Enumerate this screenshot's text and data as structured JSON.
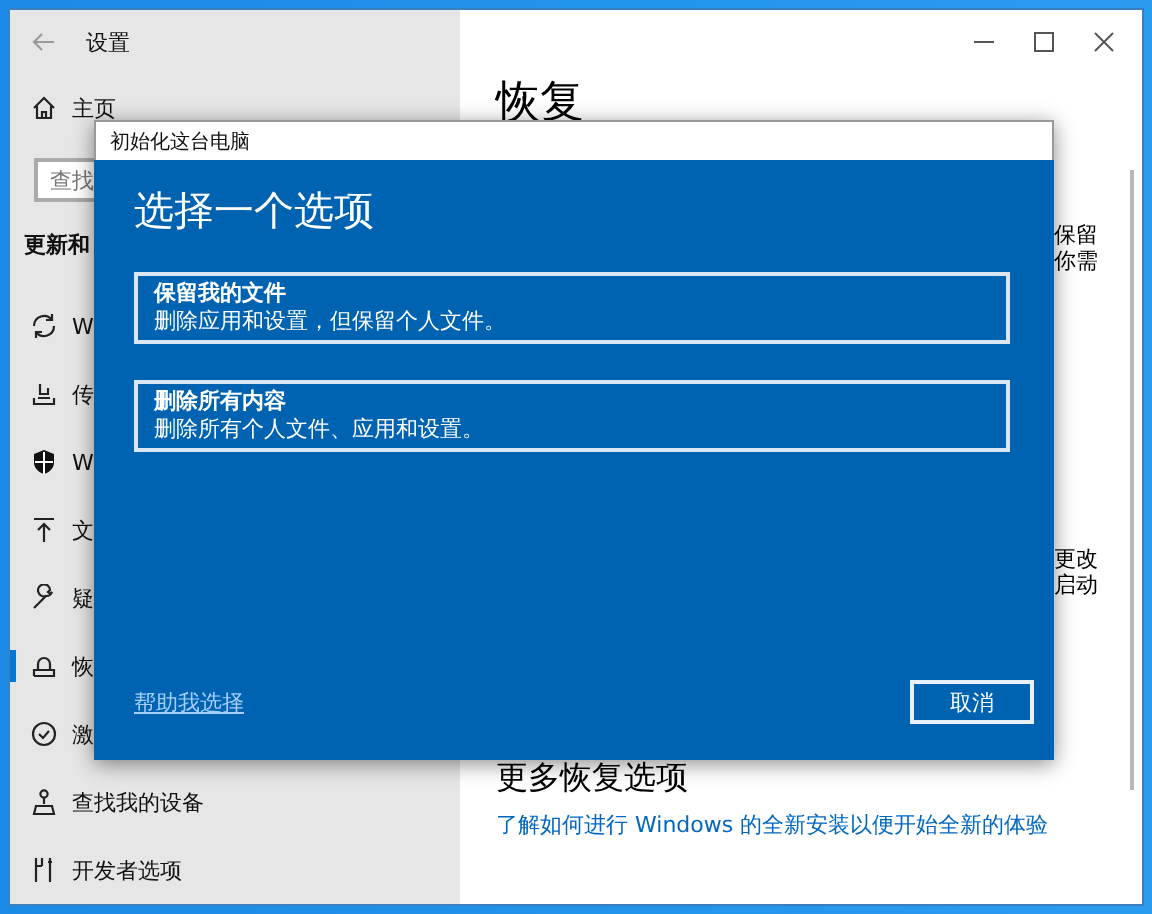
{
  "window": {
    "title": "设置"
  },
  "sidebar": {
    "home": "主页",
    "search": {
      "placeholder": "查找"
    },
    "section": "更新和",
    "items": [
      {
        "label": "W",
        "selected": false
      },
      {
        "label": "传",
        "selected": false
      },
      {
        "label": "W",
        "selected": false
      },
      {
        "label": "文",
        "selected": false
      },
      {
        "label": "疑",
        "selected": false
      },
      {
        "label": "恢",
        "selected": true
      },
      {
        "label": "激",
        "selected": false
      },
      {
        "label": "查找我的设备",
        "selected": false
      },
      {
        "label": "开发者选项",
        "selected": false
      }
    ]
  },
  "content": {
    "title": "恢复",
    "fragments": [
      [
        "保留",
        "你需"
      ],
      [
        "更改",
        "启动"
      ]
    ],
    "more_heading": "更多恢复选项",
    "link": "了解如何进行 Windows 的全新安装以便开始全新的体验"
  },
  "dialog": {
    "title": "初始化这台电脑",
    "heading": "选择一个选项",
    "options": [
      {
        "title": "保留我的文件",
        "description": "删除应用和设置，但保留个人文件。"
      },
      {
        "title": "删除所有内容",
        "description": "删除所有个人文件、应用和设置。"
      }
    ],
    "help_link": "帮助我选择",
    "cancel": "取消"
  }
}
